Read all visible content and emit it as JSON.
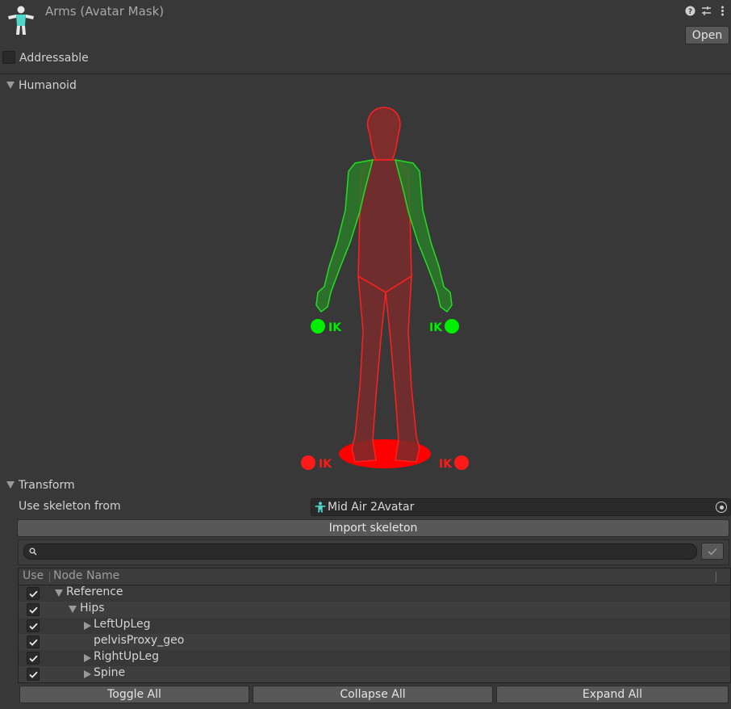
{
  "header": {
    "title": "Arms (Avatar Mask)",
    "open_label": "Open",
    "icons": [
      "help-icon",
      "presets-icon",
      "kebab-menu-icon"
    ]
  },
  "addressable": {
    "label": "Addressable",
    "checked": false
  },
  "humanoid": {
    "label": "Humanoid",
    "expanded": true,
    "ik_label": "IK",
    "colors": {
      "enabled": "#00e000",
      "disabled": "#ff1a1a"
    }
  },
  "transform": {
    "label": "Transform",
    "expanded": true,
    "skeleton_label": "Use skeleton from",
    "skeleton_value": "Mid Air 2Avatar",
    "import_label": "Import skeleton",
    "search_placeholder": "",
    "columns": {
      "use": "Use",
      "node_name": "Node Name"
    },
    "nodes": [
      {
        "name": "Reference",
        "checked": true,
        "depth": 0,
        "expander": "open"
      },
      {
        "name": "Hips",
        "checked": true,
        "depth": 1,
        "expander": "open"
      },
      {
        "name": "LeftUpLeg",
        "checked": true,
        "depth": 2,
        "expander": "closed"
      },
      {
        "name": "pelvisProxy_geo",
        "checked": true,
        "depth": 2,
        "expander": "none"
      },
      {
        "name": "RightUpLeg",
        "checked": true,
        "depth": 2,
        "expander": "closed"
      },
      {
        "name": "Spine",
        "checked": true,
        "depth": 2,
        "expander": "closed"
      }
    ],
    "buttons": {
      "toggle_all": "Toggle All",
      "collapse_all": "Collapse All",
      "expand_all": "Expand All"
    }
  }
}
